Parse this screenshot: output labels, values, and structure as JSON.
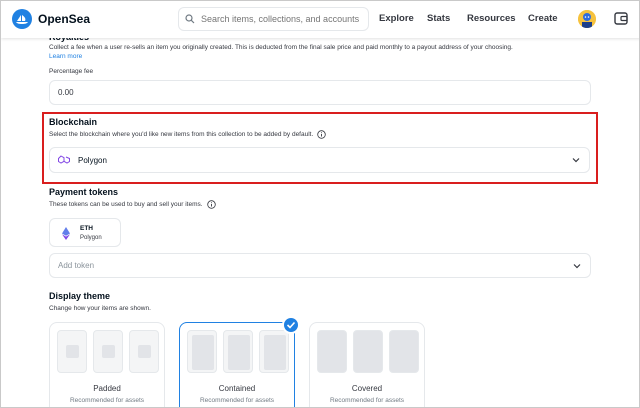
{
  "header": {
    "brand": "OpenSea",
    "search_placeholder": "Search items, collections, and accounts",
    "nav": [
      "Explore",
      "Stats",
      "Resources",
      "Create"
    ]
  },
  "royalties": {
    "title": "Royalties",
    "description": "Collect a fee when a user re-sells an item you originally created. This is deducted from the final sale price and paid monthly to a payout address of your choosing.",
    "link": "Learn more",
    "fee_label": "Percentage fee",
    "fee_value": "0.00"
  },
  "blockchain": {
    "title": "Blockchain",
    "description": "Select the blockchain where you'd like new items from this collection to be added by default.",
    "selected": "Polygon"
  },
  "payment_tokens": {
    "title": "Payment tokens",
    "description": "These tokens can be used to buy and sell your items.",
    "token_symbol": "ETH",
    "token_network": "Polygon",
    "add_placeholder": "Add token"
  },
  "display_theme": {
    "title": "Display theme",
    "description": "Change how your items are shown.",
    "options": [
      {
        "name": "Padded",
        "desc": "Recommended for assets"
      },
      {
        "name": "Contained",
        "desc": "Recommended for assets"
      },
      {
        "name": "Covered",
        "desc": "Recommended for assets"
      }
    ],
    "selected_index": 1
  },
  "colors": {
    "accent": "#2081e2",
    "highlight": "#d91e1e",
    "polygon": "#8247e5"
  }
}
